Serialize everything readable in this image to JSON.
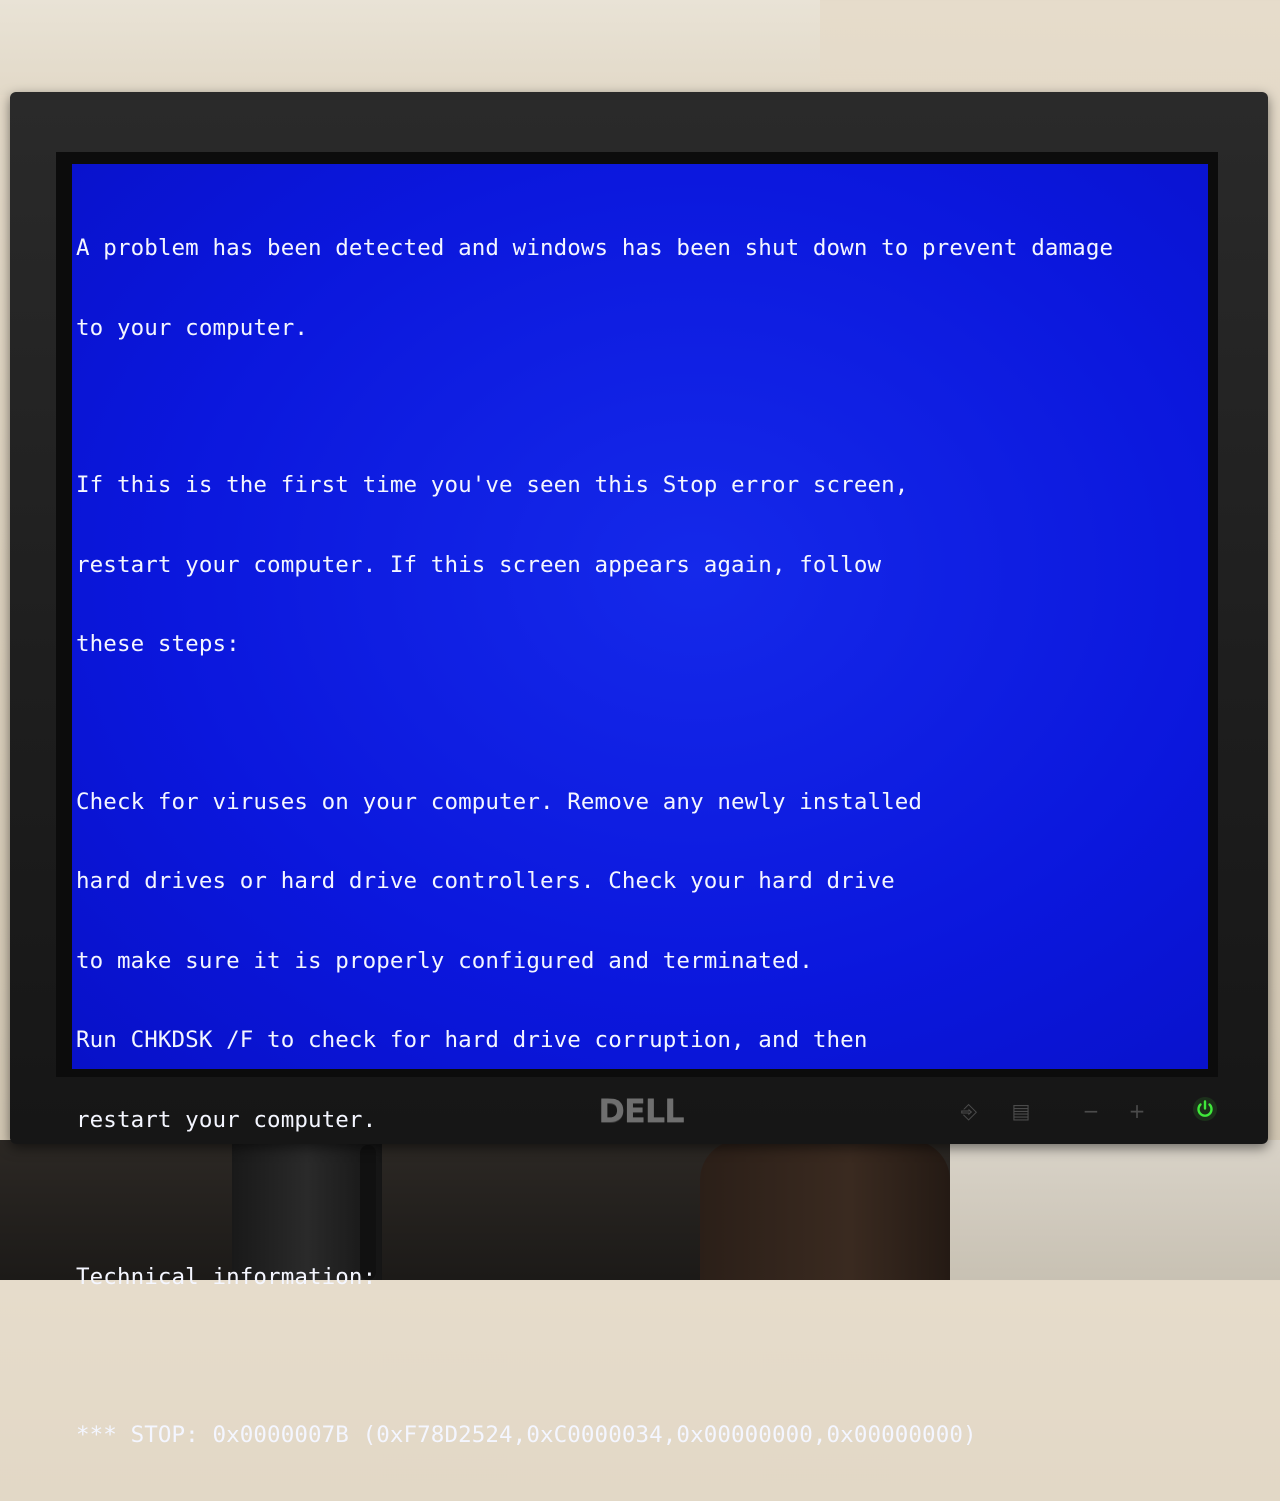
{
  "bsod": {
    "lines": [
      "A problem has been detected and windows has been shut down to prevent damage",
      "to your computer.",
      "",
      "If this is the first time you've seen this Stop error screen,",
      "restart your computer. If this screen appears again, follow",
      "these steps:",
      "",
      "Check for viruses on your computer. Remove any newly installed",
      "hard drives or hard drive controllers. Check your hard drive",
      "to make sure it is properly configured and terminated.",
      "Run CHKDSK /F to check for hard drive corruption, and then",
      "restart your computer.",
      "",
      "Technical information:",
      "",
      "*** STOP: 0x0000007B (0xF78D2524,0xC0000034,0x00000000,0x00000000)"
    ]
  },
  "monitor": {
    "brand": "DELL",
    "controls": [
      {
        "icon": "input-source-icon",
        "glyph": "⎆"
      },
      {
        "icon": "menu-icon",
        "glyph": "▤"
      },
      {
        "icon": "minus-icon",
        "glyph": "−"
      },
      {
        "icon": "plus-icon",
        "glyph": "+"
      },
      {
        "icon": "power-icon",
        "glyph": "⏻"
      }
    ]
  },
  "colors": {
    "bsod_background": "#0b17dd",
    "bsod_text": "#f4f6ff",
    "power_led": "#3fe83a"
  }
}
